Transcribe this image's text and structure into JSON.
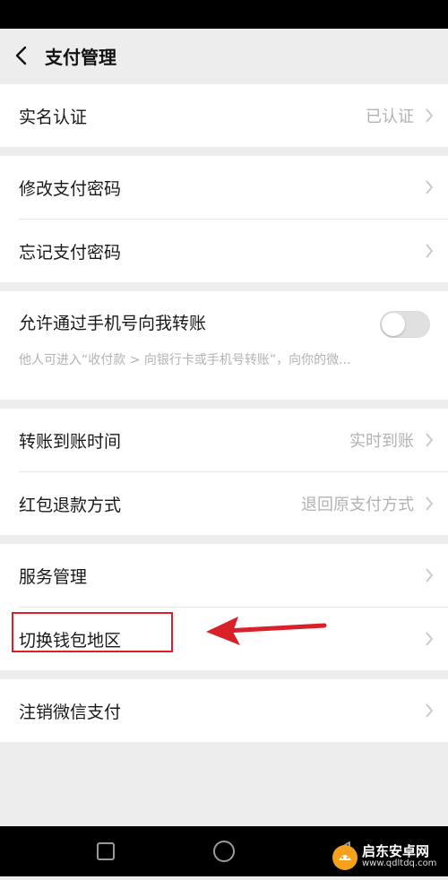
{
  "header": {
    "title": "支付管理"
  },
  "rows": {
    "real_name": {
      "label": "实名认证",
      "value": "已认证"
    },
    "modify_password": {
      "label": "修改支付密码"
    },
    "forgot_password": {
      "label": "忘记支付密码"
    },
    "phone_transfer": {
      "label": "允许通过手机号向我转账",
      "description": "他人可进入“收付款 > 向银行卡或手机号转账”，向你的微...",
      "enabled": false
    },
    "transfer_time": {
      "label": "转账到账时间",
      "value": "实时到账"
    },
    "red_packet_refund": {
      "label": "红包退款方式",
      "value": "退回原支付方式"
    },
    "service_management": {
      "label": "服务管理"
    },
    "switch_wallet_region": {
      "label": "切换钱包地区"
    },
    "cancel_wechat_pay": {
      "label": "注销微信支付"
    }
  },
  "annotation": {
    "color": "#d9212a"
  },
  "watermark": {
    "name": "启东安卓网",
    "url": "www.qdltdq.com"
  },
  "icons": {
    "back": "chevron-left-icon",
    "row": "chevron-right-icon",
    "system": [
      "square-icon",
      "circle-icon",
      "triangle-back-icon"
    ]
  }
}
